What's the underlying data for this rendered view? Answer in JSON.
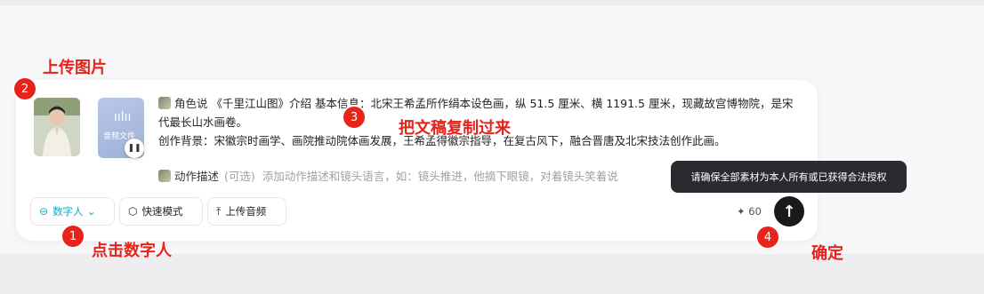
{
  "colors": {
    "accent": "#1aa7c9",
    "annotation": "#e8231a",
    "send": "#1a1a1a",
    "tooltip": "#2b2b2f"
  },
  "media": {
    "avatar_icon": "person-photo",
    "audio_label": "音频文件",
    "audio_icon": "sound-wave-icon",
    "pause_icon": "pause-icon"
  },
  "script": {
    "tag": "角色说",
    "text": "《千里江山图》介绍 基本信息：北宋王希孟所作绢本设色画，纵 51.5 厘米、横 1191.5 厘米，现藏故宫博物院，是宋代最长山水画卷。",
    "line2": "创作背景：宋徽宗时画学、画院推动院体画发展，王希孟得徽宗指导，在复古风下，融合晋唐及北宋技法创作此画。"
  },
  "action": {
    "tag": "动作描述",
    "optional": "(可选)",
    "placeholder": "添加动作描述和镜头语言，如：镜头推进，他摘下眼镜，对着镜头笑着说"
  },
  "tooltip": "请确保全部素材为本人所有或已获得合法授权",
  "toolbar": {
    "digital_human": "数字人",
    "fast_mode": "快速模式",
    "upload_audio": "上传音频",
    "credits": "60",
    "credits_icon": "sparkle-icon",
    "send_icon": "arrow-up-icon"
  },
  "annotations": {
    "n1": "1",
    "n2": "2",
    "n3": "3",
    "n4": "4",
    "upload_image": "上传图片",
    "paste_script": "把文稿复制过来",
    "click_digital": "点击数字人",
    "confirm": "确定"
  }
}
